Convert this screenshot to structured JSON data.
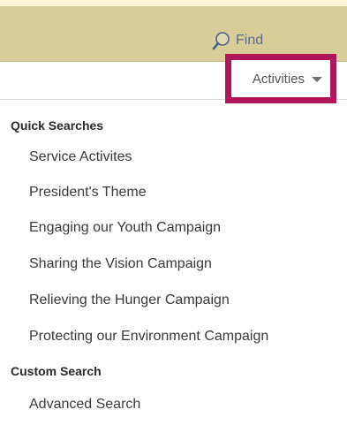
{
  "toolbar": {
    "find_label": "Find",
    "find_icon": "magnifier-icon",
    "activities_label": "Activities",
    "activities_icon": "caret-down-icon"
  },
  "colors": {
    "find_bar_background": "#d8cd99",
    "highlight_border": "#b0175a",
    "find_text": "#5b6b8c"
  },
  "menu": {
    "quick_searches": {
      "heading": "Quick Searches",
      "items": [
        "Service Activites",
        "President's Theme",
        "Engaging our Youth Campaign",
        "Sharing the Vision Campaign",
        "Relieving the Hunger Campaign",
        "Protecting our Environment Campaign"
      ]
    },
    "custom_search": {
      "heading": "Custom Search",
      "items": [
        "Advanced Search"
      ]
    }
  }
}
